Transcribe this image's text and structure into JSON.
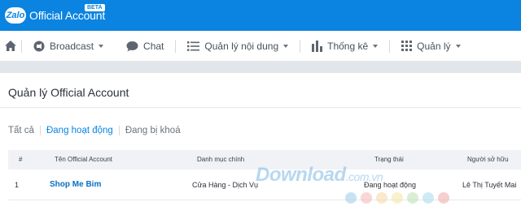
{
  "app": {
    "logo_text": "Zalo",
    "brand": "Official Account",
    "badge": "BETA",
    "colors": {
      "header": "#0a84e0",
      "link": "#0a6fc2"
    }
  },
  "nav": {
    "home_icon": "home-icon",
    "items": [
      {
        "label": "Broadcast",
        "icon": "broadcast-icon",
        "dropdown": true
      },
      {
        "label": "Chat",
        "icon": "chat-bubble-icon",
        "dropdown": false
      },
      {
        "label": "Quản lý nội dung",
        "icon": "list-icon",
        "dropdown": true
      },
      {
        "label": "Thống kê",
        "icon": "bar-chart-icon",
        "dropdown": true
      },
      {
        "label": "Quản lý",
        "icon": "grid-icon",
        "dropdown": true
      }
    ]
  },
  "page": {
    "title": "Quản lý Official Account",
    "tabs": [
      {
        "label": "Tất cả",
        "active": false
      },
      {
        "label": "Đang hoạt động",
        "active": true
      },
      {
        "label": "Đang bị khoá",
        "active": false
      }
    ]
  },
  "table": {
    "columns": [
      "#",
      "Tên Official Account",
      "Danh mục chính",
      "Trạng thái",
      "Người sở hữu"
    ],
    "rows": [
      {
        "index": "1",
        "name": "Shop Me Bim",
        "category": "Cửa Hàng - Dịch Vụ",
        "status": "Đang hoạt động",
        "owner": "Lê Thị Tuyết Mai"
      }
    ]
  },
  "watermark": {
    "text": "Download",
    "suffix": ".com.vn"
  }
}
